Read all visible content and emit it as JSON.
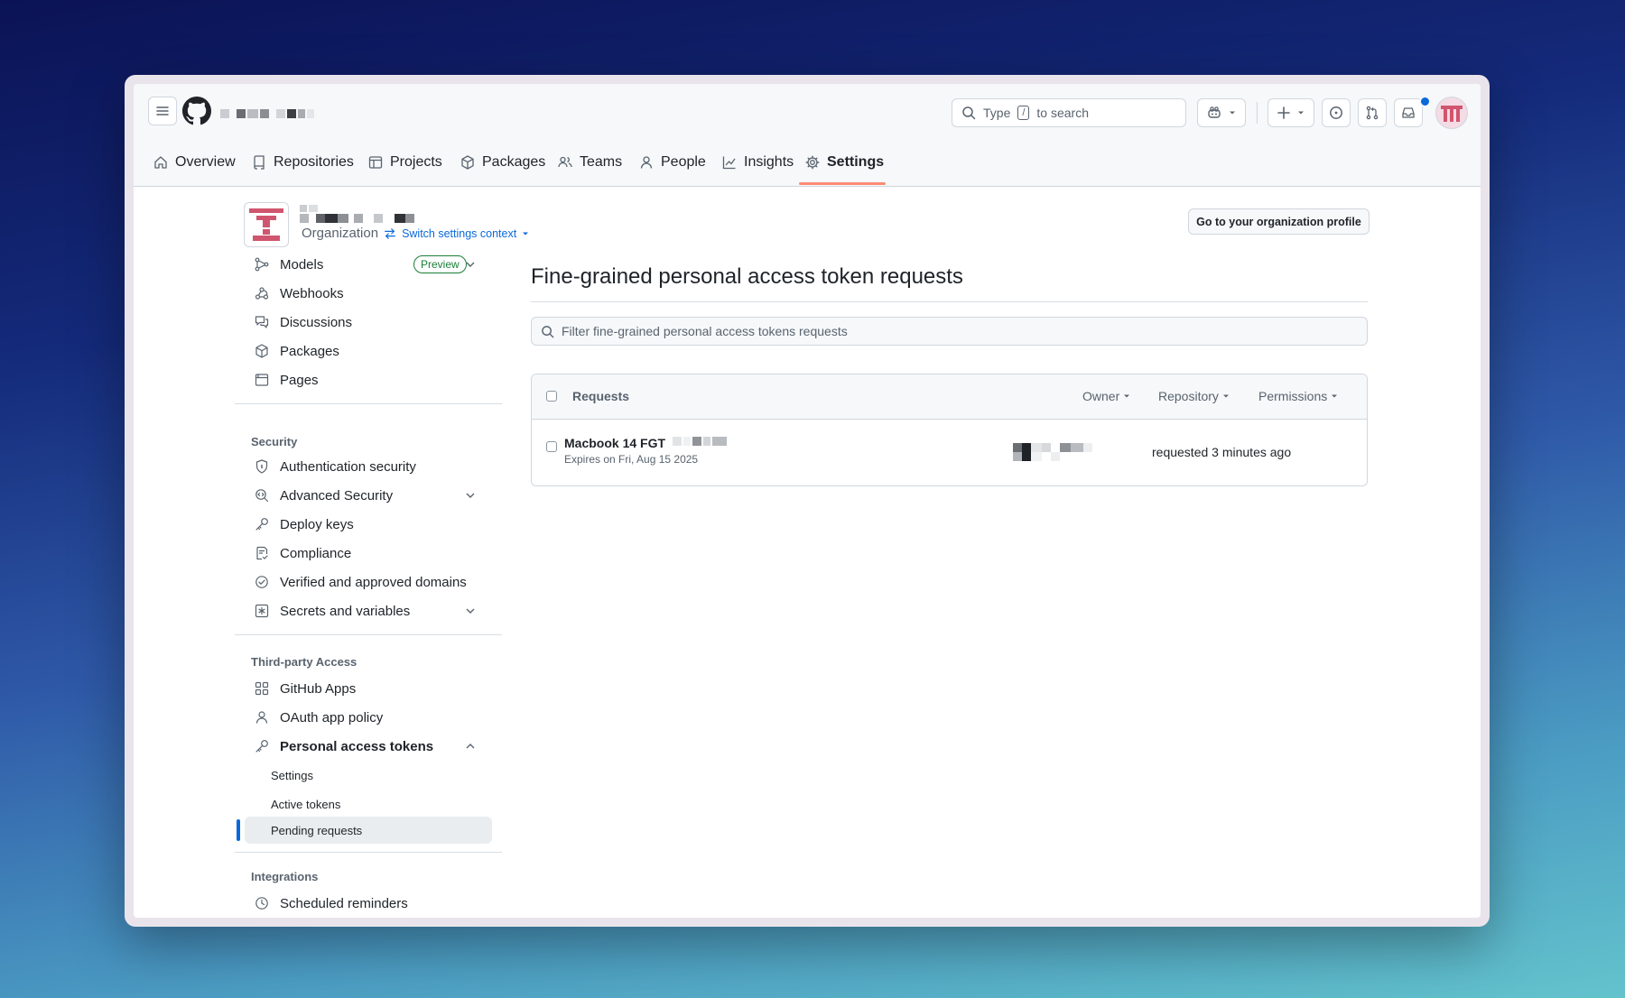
{
  "header": {
    "search_placeholder": "to search",
    "search_prefix": "Type",
    "search_key": "/"
  },
  "nav": {
    "tabs": [
      {
        "label": "Overview",
        "icon": "home-icon"
      },
      {
        "label": "Repositories",
        "icon": "repo-icon"
      },
      {
        "label": "Projects",
        "icon": "table-icon"
      },
      {
        "label": "Packages",
        "icon": "package-icon"
      },
      {
        "label": "Teams",
        "icon": "people-icon"
      },
      {
        "label": "People",
        "icon": "person-icon"
      },
      {
        "label": "Insights",
        "icon": "graph-icon"
      },
      {
        "label": "Settings",
        "icon": "gear-icon",
        "selected": true
      }
    ]
  },
  "org": {
    "type_label": "Organization",
    "switch_label": "Switch settings context",
    "profile_button": "Go to your organization profile"
  },
  "sidebar": {
    "top_items": [
      {
        "label": "Models",
        "icon": "models-icon",
        "badge": "Preview"
      },
      {
        "label": "Webhooks",
        "icon": "webhook-icon"
      },
      {
        "label": "Discussions",
        "icon": "discussions-icon"
      },
      {
        "label": "Packages",
        "icon": "package-icon"
      },
      {
        "label": "Pages",
        "icon": "browser-icon"
      }
    ],
    "security_heading": "Security",
    "security_items": [
      {
        "label": "Authentication security",
        "icon": "shield-lock-icon"
      },
      {
        "label": "Advanced Security",
        "icon": "codescan-icon"
      },
      {
        "label": "Deploy keys",
        "icon": "key-icon"
      },
      {
        "label": "Compliance",
        "icon": "checklist-icon"
      },
      {
        "label": "Verified and approved domains",
        "icon": "verified-icon"
      },
      {
        "label": "Secrets and variables",
        "icon": "asterisk-icon"
      }
    ],
    "third_party_heading": "Third-party Access",
    "third_party_items": [
      {
        "label": "GitHub Apps",
        "icon": "apps-icon"
      },
      {
        "label": "OAuth app policy",
        "icon": "person-icon"
      },
      {
        "label": "Personal access tokens",
        "icon": "key-icon"
      }
    ],
    "pat_subitems": [
      {
        "label": "Settings"
      },
      {
        "label": "Active tokens"
      },
      {
        "label": "Pending requests",
        "selected": true
      }
    ],
    "integrations_heading": "Integrations",
    "integrations_items": [
      {
        "label": "Scheduled reminders",
        "icon": "clock-icon"
      }
    ]
  },
  "main": {
    "title": "Fine-grained personal access token requests",
    "filter_placeholder": "Filter fine-grained personal access tokens requests",
    "table": {
      "header_label": "Requests",
      "filters": [
        "Owner",
        "Repository",
        "Permissions"
      ],
      "rows": [
        {
          "name": "Macbook 14 FGT",
          "expires": "Expires on Fri, Aug 15 2025",
          "requested": "requested 3 minutes ago"
        }
      ]
    }
  }
}
